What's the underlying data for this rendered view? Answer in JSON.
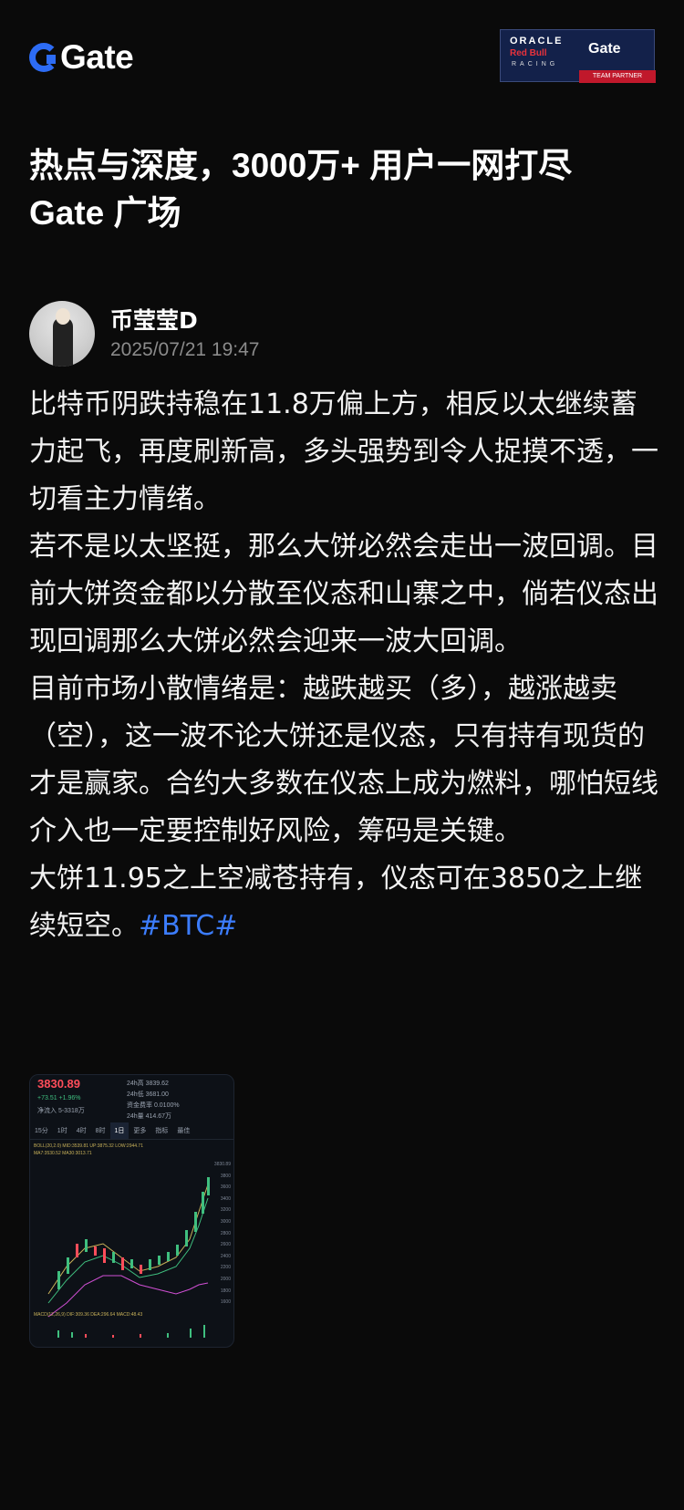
{
  "header": {
    "logo_text": "Gate",
    "partner_badge": {
      "oracle": "ORACLE",
      "redbull": "Red Bull",
      "racing": "RACING",
      "gate": "Gate",
      "partner": "TEAM PARTNER"
    }
  },
  "headline": {
    "line1": "热点与深度，3000万+ 用户一网打尽",
    "line2": "Gate 广场"
  },
  "author": {
    "name": "币莹莹D",
    "timestamp": "2025/07/21 19:47"
  },
  "post": {
    "paragraphs": [
      "比特币阴跌持稳在11.8万偏上方，相反以太继续蓄力起飞，再度刷新高，多头强势到令人捉摸不透，一切看主力情绪。",
      "若不是以太坚挺，那么大饼必然会走出一波回调。目前大饼资金都以分散至仪态和山寨之中，倘若仪态出现回调那么大饼必然会迎来一波大回调。",
      "目前市场小散情绪是：越跌越买（多），越涨越卖（空），这一波不论大饼还是仪态，只有持有现货的才是赢家。合约大多数在仪态上成为燃料，哪怕短线介入也一定要控制好风险，筹码是关键。"
    ],
    "last_paragraph_text": "大饼11.95之上空减苍持有，仪态可在3850之上继续短空。",
    "hashtag": "#BTC#"
  },
  "chart_thumb": {
    "price": "3830.89",
    "change": "+73.51  +1.96%",
    "funding": "净流入  5-3318万",
    "stats": [
      "24h高 3839.62",
      "24h低 3681.00",
      "资金费率 0.0100%",
      "24h量 414.67万"
    ],
    "tabs": [
      "15分",
      "1时",
      "4时",
      "8时",
      "1日",
      "更多",
      "指标",
      "最佳"
    ],
    "active_tab": "1日",
    "indicator_line1": "BOLL(20,2.0)  MID:3539.81  UP:3875.32  LOW:2944.71",
    "indicator_line2": "MA7:3530.52  MA30:3013.71",
    "axis_labels": [
      "3830.89",
      "3800",
      "3600",
      "3400",
      "3200",
      "3000",
      "2800",
      "2600",
      "2400",
      "2200",
      "2000",
      "1800",
      "1600"
    ],
    "macd_label": "MACD(12,26,9)  DIF:309.36  DEA:296.64  MACD:48.43"
  },
  "colors": {
    "background": "#0a0a0a",
    "accent_blue": "#3c7dff",
    "up_green": "#3fbf7f",
    "down_red": "#ff4d5a"
  }
}
